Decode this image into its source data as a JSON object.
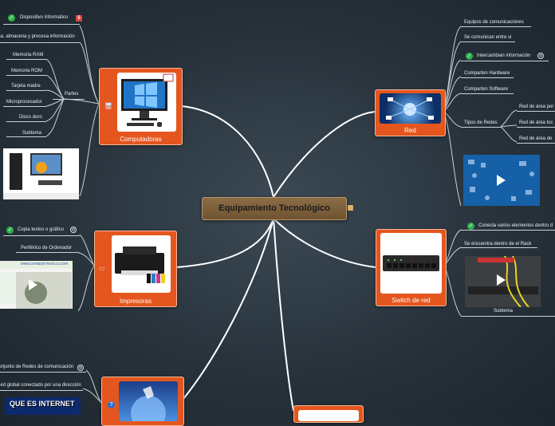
{
  "central": {
    "title": "Equipamiento Tecnológico"
  },
  "computadoras": {
    "caption": "Computadoras",
    "items": [
      "Dispositivo Informático",
      "Procesa, almacena y procesa información"
    ],
    "group_label": "Partes",
    "parts": [
      "Memoria RAM",
      "Memoria ROM",
      "Tarjeta madre",
      "Microprocesador",
      "Disco duro",
      "Subtema"
    ],
    "badge": "5"
  },
  "impresoras": {
    "caption": "Impresoras",
    "items": [
      "Copia textos o gráfico",
      "Periférico de Ordenador"
    ],
    "thumb_url": "www.contacto-host.cu.com"
  },
  "internet": {
    "items": [
      "Conjunto de Redes de comunicación",
      "Red global conectado por una dirección"
    ],
    "thumb_text": "QUE ES INTERNET"
  },
  "red": {
    "caption": "Red",
    "items": [
      "Equipos de comunicaciones",
      "Se comunican entre si",
      "Intercambian información",
      "Comparten Hardware",
      "Comparten Software",
      "Tipos de Redes"
    ],
    "tipos": [
      "Red de área per",
      "Red de área loc",
      "Red de área de"
    ]
  },
  "switch": {
    "caption": "Switch de red",
    "items": [
      "Conecta varios elementos dentro d",
      "Se encuentra dentro de el Rack"
    ],
    "thumb_caption": "Subtema"
  },
  "colors": {
    "node": "#e4561e",
    "central": "#7a5c38",
    "background": "#2b363f",
    "line": "#ffffff"
  }
}
